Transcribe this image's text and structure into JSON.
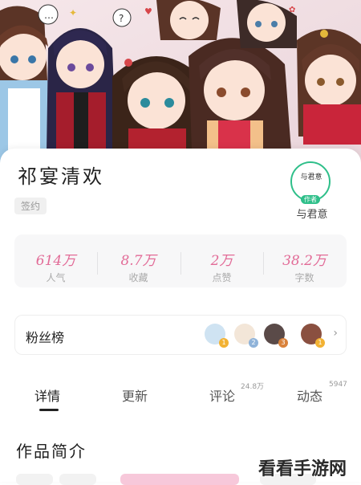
{
  "book": {
    "title": "祁宴清欢",
    "tag": "签约"
  },
  "author": {
    "avatar_text": "与君意",
    "badge": "作者",
    "name": "与君意"
  },
  "stats": [
    {
      "value": "614万",
      "label": "人气"
    },
    {
      "value": "8.7万",
      "label": "收藏"
    },
    {
      "value": "2万",
      "label": "点赞"
    },
    {
      "value": "38.2万",
      "label": "字数"
    }
  ],
  "fans": {
    "label": "粉丝榜",
    "ranks": [
      "1",
      "2",
      "3",
      "1"
    ]
  },
  "tabs": [
    {
      "label": "详情",
      "count": ""
    },
    {
      "label": "更新",
      "count": ""
    },
    {
      "label": "评论",
      "count": "24.8万"
    },
    {
      "label": "动态",
      "count": "5947"
    }
  ],
  "section_title": "作品简介",
  "watermark": "看看手游网",
  "colors": {
    "accent": "#e26b97",
    "author_ring": "#2fbf8a",
    "rank_gold": "#f2b233",
    "rank_silver": "#8fb3d9",
    "rank_bronze": "#d9823b"
  }
}
